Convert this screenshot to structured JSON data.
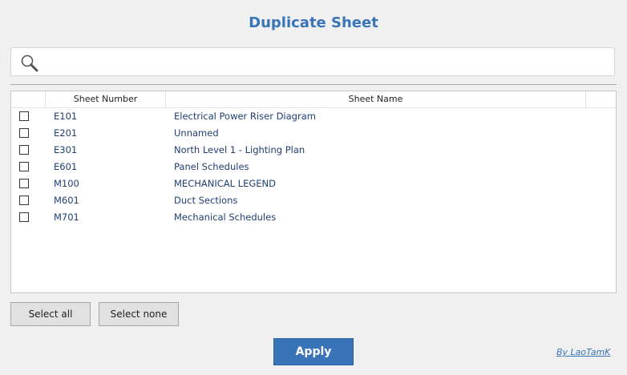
{
  "window": {
    "title": "Duplicate Sheet"
  },
  "search": {
    "value": "",
    "placeholder": "",
    "icon": "search-icon"
  },
  "table": {
    "columns": [
      "",
      "Sheet Number",
      "Sheet Name",
      ""
    ],
    "rows": [
      {
        "checked": false,
        "number": "E101",
        "name": "Electrical Power Riser Diagram"
      },
      {
        "checked": false,
        "number": "E201",
        "name": "Unnamed"
      },
      {
        "checked": false,
        "number": "E301",
        "name": "North Level 1 - Lighting Plan"
      },
      {
        "checked": false,
        "number": "E601",
        "name": "Panel Schedules"
      },
      {
        "checked": false,
        "number": "M100",
        "name": "MECHANICAL LEGEND"
      },
      {
        "checked": false,
        "number": "M601",
        "name": "Duct Sections"
      },
      {
        "checked": false,
        "number": "M701",
        "name": "Mechanical Schedules"
      }
    ]
  },
  "buttons": {
    "select_all": "Select all",
    "select_none": "Select none",
    "apply": "Apply"
  },
  "footer": {
    "credit": "By LaoTamK"
  },
  "colors": {
    "accent": "#3973b8",
    "row_text": "#1f3e72",
    "background": "#f0f0f0"
  }
}
